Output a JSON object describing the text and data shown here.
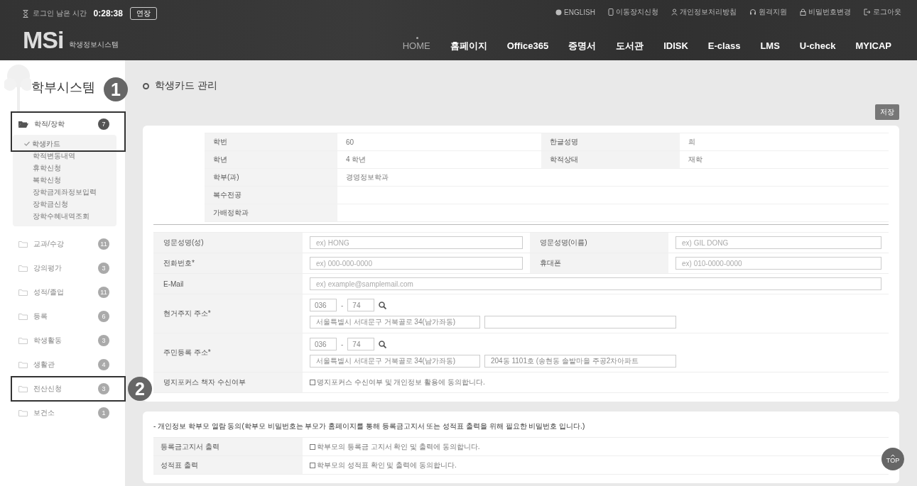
{
  "header": {
    "timer_label": "로그인 남은 시간",
    "timer_value": "0:28:38",
    "extend_button": "연장",
    "logo": "MSi",
    "logo_subtitle": "학생정보시스템",
    "utility_links": [
      {
        "label": "ENGLISH"
      },
      {
        "label": "이동장치신청"
      },
      {
        "label": "개인정보처리방침"
      },
      {
        "label": "원격지원"
      },
      {
        "label": "비밀번호변경"
      },
      {
        "label": "로그아웃"
      }
    ],
    "nav": [
      {
        "label": "HOME",
        "selected": true
      },
      {
        "label": "홈페이지",
        "selected": false
      },
      {
        "label": "Office365",
        "selected": false
      },
      {
        "label": "증명서",
        "selected": false
      },
      {
        "label": "도서관",
        "selected": false
      },
      {
        "label": "IDISK",
        "selected": false
      },
      {
        "label": "E-class",
        "selected": false
      },
      {
        "label": "LMS",
        "selected": false
      },
      {
        "label": "U-check",
        "selected": false
      },
      {
        "label": "MYICAP",
        "selected": false
      }
    ]
  },
  "sidebar": {
    "title": "학부시스템",
    "sections": [
      {
        "label": "학적/장학",
        "count": "7",
        "expanded": true,
        "marker": "1",
        "children": [
          {
            "label": "학생카드",
            "selected": true
          },
          {
            "label": "학적변동내역",
            "selected": false
          },
          {
            "label": "휴학신청",
            "selected": false
          },
          {
            "label": "복학신청",
            "selected": false
          },
          {
            "label": "장학금계좌정보입력",
            "selected": false
          },
          {
            "label": "장학금신청",
            "selected": false
          },
          {
            "label": "장학수혜내역조회",
            "selected": false
          }
        ]
      },
      {
        "label": "교과/수강",
        "count": "11",
        "expanded": false
      },
      {
        "label": "강의평가",
        "count": "3",
        "expanded": false
      },
      {
        "label": "성적/졸업",
        "count": "11",
        "expanded": false
      },
      {
        "label": "등록",
        "count": "6",
        "expanded": false
      },
      {
        "label": "학생활동",
        "count": "3",
        "expanded": false
      },
      {
        "label": "생활관",
        "count": "4",
        "expanded": false
      },
      {
        "label": "전산신청",
        "count": "3",
        "expanded": false,
        "marker": "2"
      },
      {
        "label": "보건소",
        "count": "1",
        "expanded": false
      }
    ]
  },
  "page": {
    "title": "학생카드 관리",
    "save_button": "저장"
  },
  "student_info": [
    {
      "label": "학번",
      "value": "60",
      "label_2": "한글성명",
      "value_2": "희"
    },
    {
      "label": "학년",
      "value": "4 학년",
      "label_2": "학적상태",
      "value_2": "재학"
    },
    {
      "label": "학부(과)",
      "value": "경영정보학과"
    },
    {
      "label": "복수전공"
    },
    {
      "label": "가배정학과"
    }
  ],
  "form": [
    {
      "kind": "pair",
      "label": "영문성명(성)",
      "placeholder": "ex) HONG",
      "label_2": "영문성명(이름)",
      "placeholder_2": "ex) GIL DONG"
    },
    {
      "kind": "pair",
      "label": "전화번호*",
      "placeholder": "ex) 000-000-0000",
      "label_2": "휴대폰",
      "placeholder_2": "ex) 010-0000-0000"
    },
    {
      "kind": "single",
      "label": "E-Mail",
      "placeholder": "ex) example@samplemail.com"
    },
    {
      "kind": "address",
      "label": "현거주지 주소*",
      "zip_1": "036",
      "separator": "-",
      "zip_2": "74",
      "address": "서울특별시 서대문구 거북골로 34(남가좌동)"
    },
    {
      "kind": "address",
      "label": "주민등록 주소*",
      "zip_1": "036",
      "separator": "-",
      "zip_2": "74",
      "address": "서울특별시 서대문구 거북골로 34(남가좌동)",
      "detail": "204동 1101호 (송현동 솔밭마을 주공2차아파트"
    },
    {
      "kind": "checkbox",
      "label": "명지포커스 책자 수신여부",
      "option": "명지포커스 수신여부 및 개인정보 활용에 동의합니다.",
      "checked": false
    }
  ],
  "parent_consent": {
    "notice": "- 개인정보 학부모 열람 동의(학부모 비밀번호는 부모가 홈페이지를 통해 등록금고지서 또는 성적표 출력을 위해 필요한 비밀번호 입니다.)",
    "rows": [
      {
        "label": "등록금고지서 출력",
        "option": "학부모의 등록금 고지서 확인 및 출력에 동의합니다.",
        "checked": false
      },
      {
        "label": "성적표 출력",
        "option": "학부모의 성적표 확인 및 출력에 동의합니다.",
        "checked": false
      }
    ]
  },
  "top_button": "TOP"
}
